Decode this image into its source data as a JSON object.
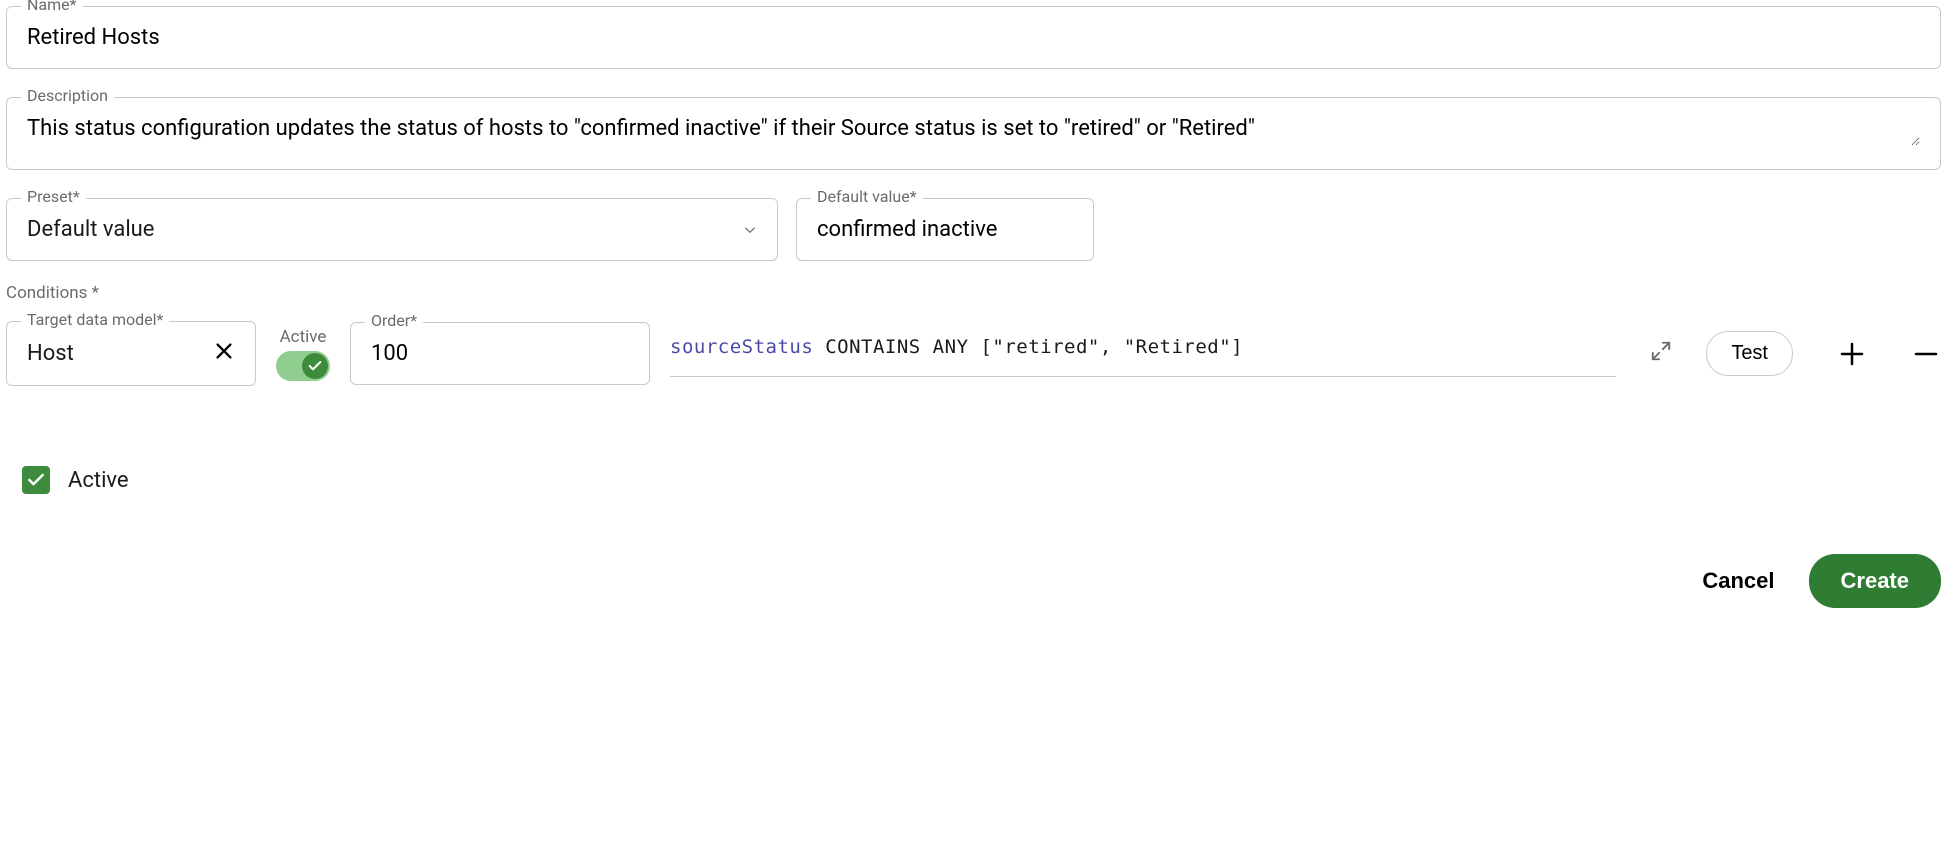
{
  "labels": {
    "name": "Name*",
    "description": "Description",
    "preset": "Preset*",
    "default_value": "Default value*",
    "conditions": "Conditions *",
    "target": "Target data model*",
    "order": "Order*",
    "toggle_active": "Active",
    "test": "Test",
    "active_checkbox": "Active",
    "cancel": "Cancel",
    "create": "Create"
  },
  "values": {
    "name": "Retired Hosts",
    "description": "This status configuration updates the status of hosts to \"confirmed inactive\" if their Source status is set to \"retired\" or \"Retired\"",
    "preset": "Default value",
    "default_value": "confirmed inactive",
    "target": "Host",
    "order": "100",
    "condition_toggle_on": true,
    "active_checked": true
  },
  "expression": {
    "field": "sourceStatus",
    "op": "CONTAINS ANY",
    "args": "[\"retired\", \"Retired\"]"
  },
  "colors": {
    "accent_green": "#3e8b3e",
    "create_green": "#2e7d32",
    "border": "#c9c9c9",
    "muted": "#6b6b6b"
  }
}
